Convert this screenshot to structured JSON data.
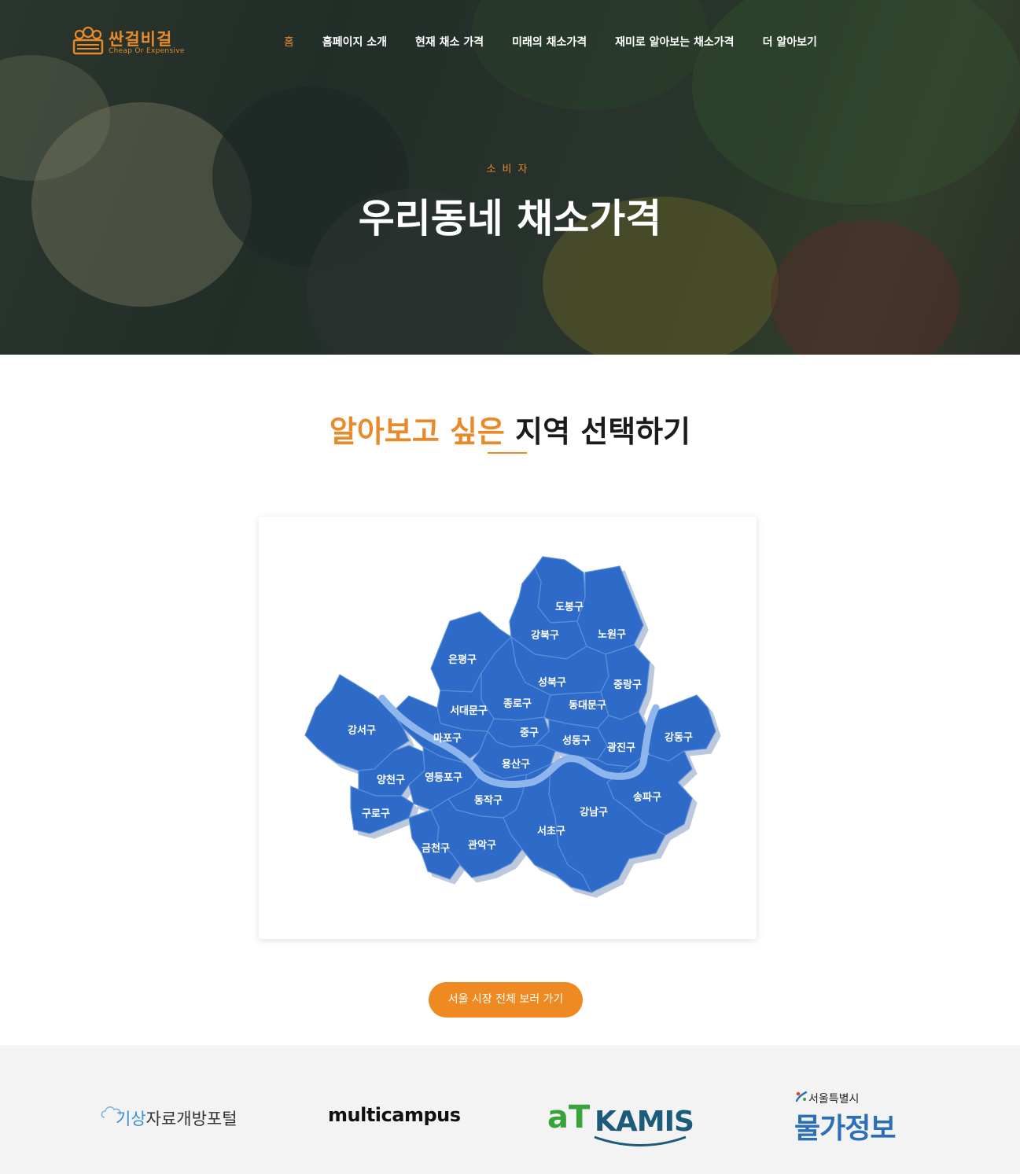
{
  "brand": {
    "name": "싼걸비걸",
    "tagline": "Cheap Or Expensive",
    "color": "#e88a2a"
  },
  "nav": {
    "items": [
      {
        "label": "홈",
        "active": true
      },
      {
        "label": "홈페이지 소개",
        "active": false
      },
      {
        "label": "현재 채소 가격",
        "active": false
      },
      {
        "label": "미래의 채소가격",
        "active": false
      },
      {
        "label": "재미로 알아보는 채소가격",
        "active": false
      },
      {
        "label": "더 알아보기",
        "active": false
      }
    ]
  },
  "hero": {
    "eyebrow": "소비자",
    "title": "우리동네 채소가격"
  },
  "section": {
    "title_accent": "알아보고 싶은",
    "title_rest": " 지역 선택하기"
  },
  "map": {
    "fill_color": "#2f6bc8",
    "river_color": "#8fb6ec",
    "districts": [
      {
        "id": "dobong",
        "label": "도봉구"
      },
      {
        "id": "gangbuk",
        "label": "강북구"
      },
      {
        "id": "nowon",
        "label": "노원구"
      },
      {
        "id": "eunpyeong",
        "label": "은평구"
      },
      {
        "id": "seongbuk",
        "label": "성북구"
      },
      {
        "id": "jungnang",
        "label": "중랑구"
      },
      {
        "id": "jongno",
        "label": "종로구"
      },
      {
        "id": "dongdaemun",
        "label": "동대문구"
      },
      {
        "id": "seodaemun",
        "label": "서대문구"
      },
      {
        "id": "gangseo",
        "label": "강서구"
      },
      {
        "id": "mapo",
        "label": "마포구"
      },
      {
        "id": "jung",
        "label": "중구"
      },
      {
        "id": "seongdong",
        "label": "성동구"
      },
      {
        "id": "gwangjin",
        "label": "광진구"
      },
      {
        "id": "gangdong",
        "label": "강동구"
      },
      {
        "id": "yongsan",
        "label": "용산구"
      },
      {
        "id": "yangcheon",
        "label": "양천구"
      },
      {
        "id": "yeongdeungpo",
        "label": "영등포구"
      },
      {
        "id": "dongjak",
        "label": "동작구"
      },
      {
        "id": "songpa",
        "label": "송파구"
      },
      {
        "id": "guro",
        "label": "구로구"
      },
      {
        "id": "gangnam",
        "label": "강남구"
      },
      {
        "id": "seocho",
        "label": "서초구"
      },
      {
        "id": "geumcheon",
        "label": "금천구"
      },
      {
        "id": "gwanak",
        "label": "관악구"
      }
    ]
  },
  "cta": {
    "label": "서울 시장 전체 보러 가기",
    "color": "#ef8a22"
  },
  "partners": {
    "weather": {
      "prefix": "기상",
      "rest": "자료개방포털"
    },
    "multicampus": "multicampus",
    "kamis": {
      "at": "aT",
      "kamis": "KAMIS"
    },
    "seoul": {
      "small": "서울특별시",
      "big": "물가정보"
    }
  }
}
